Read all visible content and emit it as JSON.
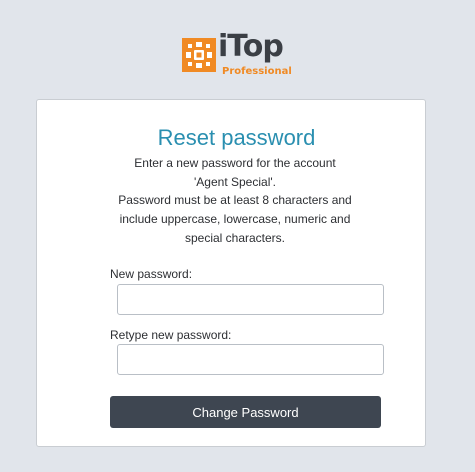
{
  "logo": {
    "name": "iTop",
    "edition": "Professional",
    "brand_color": "#f08a24",
    "icon": "itop-logo-icon"
  },
  "form": {
    "title": "Reset password",
    "message_lines": [
      "Enter a new password for the account",
      "'Agent Special'.",
      "Password must be at least 8 characters and",
      "include uppercase, lowercase, numeric and",
      "special characters."
    ],
    "new_password": {
      "label": "New password:",
      "value": ""
    },
    "retype_password": {
      "label": "Retype new password:",
      "value": ""
    },
    "submit_label": "Change Password"
  },
  "colors": {
    "background": "#e1e5eb",
    "title": "#2a8fb0",
    "button": "#3e4651"
  }
}
